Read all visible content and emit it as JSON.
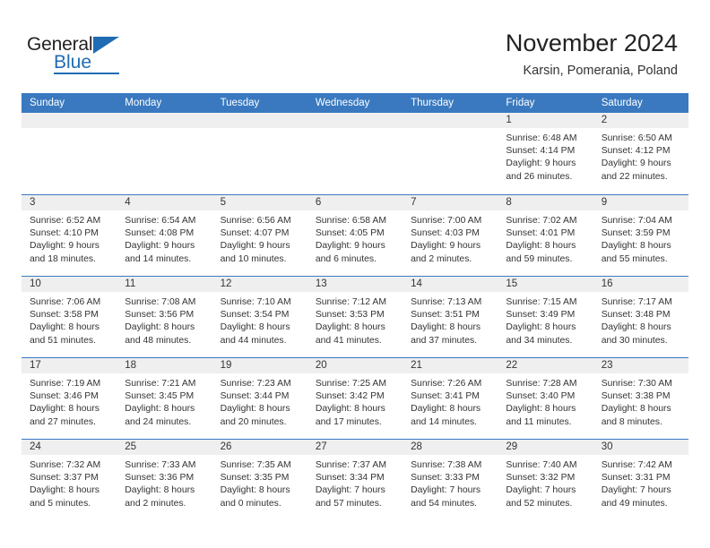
{
  "brand": {
    "name_top": "General",
    "name_bottom": "Blue",
    "accent_color": "#1f6cb4",
    "triangle_icon": "triangle-icon"
  },
  "header": {
    "title": "November 2024",
    "subtitle": "Karsin, Pomerania, Poland"
  },
  "theme": {
    "header_bg": "#3a79bf",
    "header_text": "#ffffff",
    "daynum_bg": "#efefef",
    "cell_bg": "#ffffff",
    "text": "#333333"
  },
  "weekdays": [
    "Sunday",
    "Monday",
    "Tuesday",
    "Wednesday",
    "Thursday",
    "Friday",
    "Saturday"
  ],
  "weeks": [
    [
      {
        "day": "",
        "lines": []
      },
      {
        "day": "",
        "lines": []
      },
      {
        "day": "",
        "lines": []
      },
      {
        "day": "",
        "lines": []
      },
      {
        "day": "",
        "lines": []
      },
      {
        "day": "1",
        "lines": [
          "Sunrise: 6:48 AM",
          "Sunset: 4:14 PM",
          "Daylight: 9 hours",
          "and 26 minutes."
        ]
      },
      {
        "day": "2",
        "lines": [
          "Sunrise: 6:50 AM",
          "Sunset: 4:12 PM",
          "Daylight: 9 hours",
          "and 22 minutes."
        ]
      }
    ],
    [
      {
        "day": "3",
        "lines": [
          "Sunrise: 6:52 AM",
          "Sunset: 4:10 PM",
          "Daylight: 9 hours",
          "and 18 minutes."
        ]
      },
      {
        "day": "4",
        "lines": [
          "Sunrise: 6:54 AM",
          "Sunset: 4:08 PM",
          "Daylight: 9 hours",
          "and 14 minutes."
        ]
      },
      {
        "day": "5",
        "lines": [
          "Sunrise: 6:56 AM",
          "Sunset: 4:07 PM",
          "Daylight: 9 hours",
          "and 10 minutes."
        ]
      },
      {
        "day": "6",
        "lines": [
          "Sunrise: 6:58 AM",
          "Sunset: 4:05 PM",
          "Daylight: 9 hours",
          "and 6 minutes."
        ]
      },
      {
        "day": "7",
        "lines": [
          "Sunrise: 7:00 AM",
          "Sunset: 4:03 PM",
          "Daylight: 9 hours",
          "and 2 minutes."
        ]
      },
      {
        "day": "8",
        "lines": [
          "Sunrise: 7:02 AM",
          "Sunset: 4:01 PM",
          "Daylight: 8 hours",
          "and 59 minutes."
        ]
      },
      {
        "day": "9",
        "lines": [
          "Sunrise: 7:04 AM",
          "Sunset: 3:59 PM",
          "Daylight: 8 hours",
          "and 55 minutes."
        ]
      }
    ],
    [
      {
        "day": "10",
        "lines": [
          "Sunrise: 7:06 AM",
          "Sunset: 3:58 PM",
          "Daylight: 8 hours",
          "and 51 minutes."
        ]
      },
      {
        "day": "11",
        "lines": [
          "Sunrise: 7:08 AM",
          "Sunset: 3:56 PM",
          "Daylight: 8 hours",
          "and 48 minutes."
        ]
      },
      {
        "day": "12",
        "lines": [
          "Sunrise: 7:10 AM",
          "Sunset: 3:54 PM",
          "Daylight: 8 hours",
          "and 44 minutes."
        ]
      },
      {
        "day": "13",
        "lines": [
          "Sunrise: 7:12 AM",
          "Sunset: 3:53 PM",
          "Daylight: 8 hours",
          "and 41 minutes."
        ]
      },
      {
        "day": "14",
        "lines": [
          "Sunrise: 7:13 AM",
          "Sunset: 3:51 PM",
          "Daylight: 8 hours",
          "and 37 minutes."
        ]
      },
      {
        "day": "15",
        "lines": [
          "Sunrise: 7:15 AM",
          "Sunset: 3:49 PM",
          "Daylight: 8 hours",
          "and 34 minutes."
        ]
      },
      {
        "day": "16",
        "lines": [
          "Sunrise: 7:17 AM",
          "Sunset: 3:48 PM",
          "Daylight: 8 hours",
          "and 30 minutes."
        ]
      }
    ],
    [
      {
        "day": "17",
        "lines": [
          "Sunrise: 7:19 AM",
          "Sunset: 3:46 PM",
          "Daylight: 8 hours",
          "and 27 minutes."
        ]
      },
      {
        "day": "18",
        "lines": [
          "Sunrise: 7:21 AM",
          "Sunset: 3:45 PM",
          "Daylight: 8 hours",
          "and 24 minutes."
        ]
      },
      {
        "day": "19",
        "lines": [
          "Sunrise: 7:23 AM",
          "Sunset: 3:44 PM",
          "Daylight: 8 hours",
          "and 20 minutes."
        ]
      },
      {
        "day": "20",
        "lines": [
          "Sunrise: 7:25 AM",
          "Sunset: 3:42 PM",
          "Daylight: 8 hours",
          "and 17 minutes."
        ]
      },
      {
        "day": "21",
        "lines": [
          "Sunrise: 7:26 AM",
          "Sunset: 3:41 PM",
          "Daylight: 8 hours",
          "and 14 minutes."
        ]
      },
      {
        "day": "22",
        "lines": [
          "Sunrise: 7:28 AM",
          "Sunset: 3:40 PM",
          "Daylight: 8 hours",
          "and 11 minutes."
        ]
      },
      {
        "day": "23",
        "lines": [
          "Sunrise: 7:30 AM",
          "Sunset: 3:38 PM",
          "Daylight: 8 hours",
          "and 8 minutes."
        ]
      }
    ],
    [
      {
        "day": "24",
        "lines": [
          "Sunrise: 7:32 AM",
          "Sunset: 3:37 PM",
          "Daylight: 8 hours",
          "and 5 minutes."
        ]
      },
      {
        "day": "25",
        "lines": [
          "Sunrise: 7:33 AM",
          "Sunset: 3:36 PM",
          "Daylight: 8 hours",
          "and 2 minutes."
        ]
      },
      {
        "day": "26",
        "lines": [
          "Sunrise: 7:35 AM",
          "Sunset: 3:35 PM",
          "Daylight: 8 hours",
          "and 0 minutes."
        ]
      },
      {
        "day": "27",
        "lines": [
          "Sunrise: 7:37 AM",
          "Sunset: 3:34 PM",
          "Daylight: 7 hours",
          "and 57 minutes."
        ]
      },
      {
        "day": "28",
        "lines": [
          "Sunrise: 7:38 AM",
          "Sunset: 3:33 PM",
          "Daylight: 7 hours",
          "and 54 minutes."
        ]
      },
      {
        "day": "29",
        "lines": [
          "Sunrise: 7:40 AM",
          "Sunset: 3:32 PM",
          "Daylight: 7 hours",
          "and 52 minutes."
        ]
      },
      {
        "day": "30",
        "lines": [
          "Sunrise: 7:42 AM",
          "Sunset: 3:31 PM",
          "Daylight: 7 hours",
          "and 49 minutes."
        ]
      }
    ]
  ]
}
